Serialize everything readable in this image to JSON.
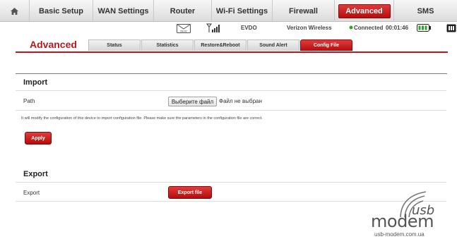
{
  "nav": {
    "items": [
      {
        "label": "Basic Setup"
      },
      {
        "label": "WAN Settings"
      },
      {
        "label": "Router"
      },
      {
        "label": "Wi-Fi Settings"
      },
      {
        "label": "Firewall"
      },
      {
        "label": "Advanced"
      },
      {
        "label": "SMS"
      }
    ],
    "home_icon": "home-icon"
  },
  "status": {
    "network": "EVDO",
    "carrier": "Verizon Wireless",
    "connection": "Connected",
    "time": "00:01:46",
    "icons": [
      "mail-new-icon",
      "signal-icon",
      "battery-icon",
      "sim-icon"
    ]
  },
  "page": {
    "title": "Advanced",
    "tabs": [
      "Status",
      "Statistics",
      "Restore&Reboot",
      "Sound Alert",
      "Config File"
    ],
    "active_tab": "Config File"
  },
  "import": {
    "heading": "Import",
    "path_label": "Path",
    "file_button": "Выберите файл",
    "file_status": "Файл не выбран",
    "note": "It will modify the configuration of this device to import configuration file. Please make sure the parameters in the configuration file are correct.",
    "apply": "Apply"
  },
  "export": {
    "heading": "Export",
    "label": "Export",
    "button": "Export file"
  },
  "watermark": {
    "usb": "usb",
    "modem": "modem",
    "url": "usb-modem.com.ua"
  },
  "colors": {
    "accent": "#c0161b",
    "connected": "#2fa32f"
  }
}
